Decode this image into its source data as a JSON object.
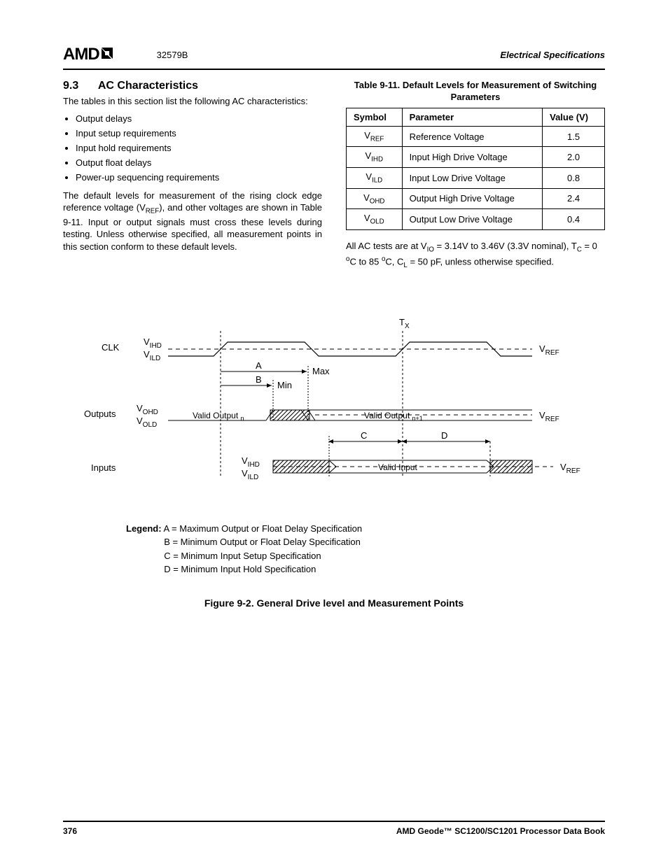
{
  "header": {
    "logo_text": "AMD",
    "doc_number": "32579B",
    "section_title": "Electrical Specifications"
  },
  "section": {
    "number": "9.3",
    "title": "AC Characteristics",
    "intro": "The tables in this section list the following AC characteristics:",
    "bullets": [
      "Output delays",
      "Input setup requirements",
      "Input hold requirements",
      "Output float delays",
      "Power-up sequencing requirements"
    ],
    "para2_a": "The default levels for measurement of the rising clock edge reference voltage (V",
    "para2_sub": "REF",
    "para2_b": "), and other voltages are shown in Table 9-11. Input or output signals must cross these levels during testing. Unless otherwise specified, all measurement points in this section conform to these default levels."
  },
  "table": {
    "caption": "Table 9-11.  Default Levels for Measurement of Switching Parameters",
    "headers": [
      "Symbol",
      "Parameter",
      "Value (V)"
    ],
    "rows": [
      {
        "sym": "V",
        "sub": "REF",
        "param": "Reference Voltage",
        "val": "1.5"
      },
      {
        "sym": "V",
        "sub": "IHD",
        "param": "Input High Drive Voltage",
        "val": "2.0"
      },
      {
        "sym": "V",
        "sub": "ILD",
        "param": "Input Low Drive Voltage",
        "val": "0.8"
      },
      {
        "sym": "V",
        "sub": "OHD",
        "param": "Output High Drive Voltage",
        "val": "2.4"
      },
      {
        "sym": "V",
        "sub": "OLD",
        "param": "Output Low Drive Voltage",
        "val": "0.4"
      }
    ]
  },
  "note_parts": {
    "a": "All AC tests are at V",
    "sub1": "IO",
    "b": " = 3.14V to 3.46V (3.3V nominal), T",
    "sub2": "C",
    "c": " = 0 ",
    "sup1": "o",
    "d": "C to 85 ",
    "sup2": "o",
    "e": "C, C",
    "sub3": "L",
    "f": " = 50 pF, unless otherwise specified."
  },
  "diagram": {
    "tx": "T",
    "tx_sub": "X",
    "clk": "CLK",
    "vihd": "V",
    "vihd_sub": "IHD",
    "vild": "V",
    "vild_sub": "ILD",
    "vref": "V",
    "vref_sub": "REF",
    "a": "A",
    "max": "Max",
    "b": "B",
    "min": "Min",
    "outputs": "Outputs",
    "vohd": "V",
    "vohd_sub": "OHD",
    "vold": "V",
    "vold_sub": "OLD",
    "valid_out_n": "Valid Output ",
    "n": "n",
    "valid_out_n1": "Valid Output ",
    "n1": "n+1",
    "c": "C",
    "d": "D",
    "inputs": "Inputs",
    "valid_input": "Valid Input"
  },
  "legend": {
    "label": "Legend:",
    "a": "A = Maximum Output or Float Delay Specification",
    "b": "B = Minimum Output or Float Delay Specification",
    "c": "C = Minimum Input Setup Specification",
    "d": "D = Minimum Input Hold Specification"
  },
  "figure_caption": "Figure 9-2.  General Drive level and Measurement Points",
  "footer": {
    "page": "376",
    "book": "AMD Geode™ SC1200/SC1201 Processor Data Book"
  }
}
